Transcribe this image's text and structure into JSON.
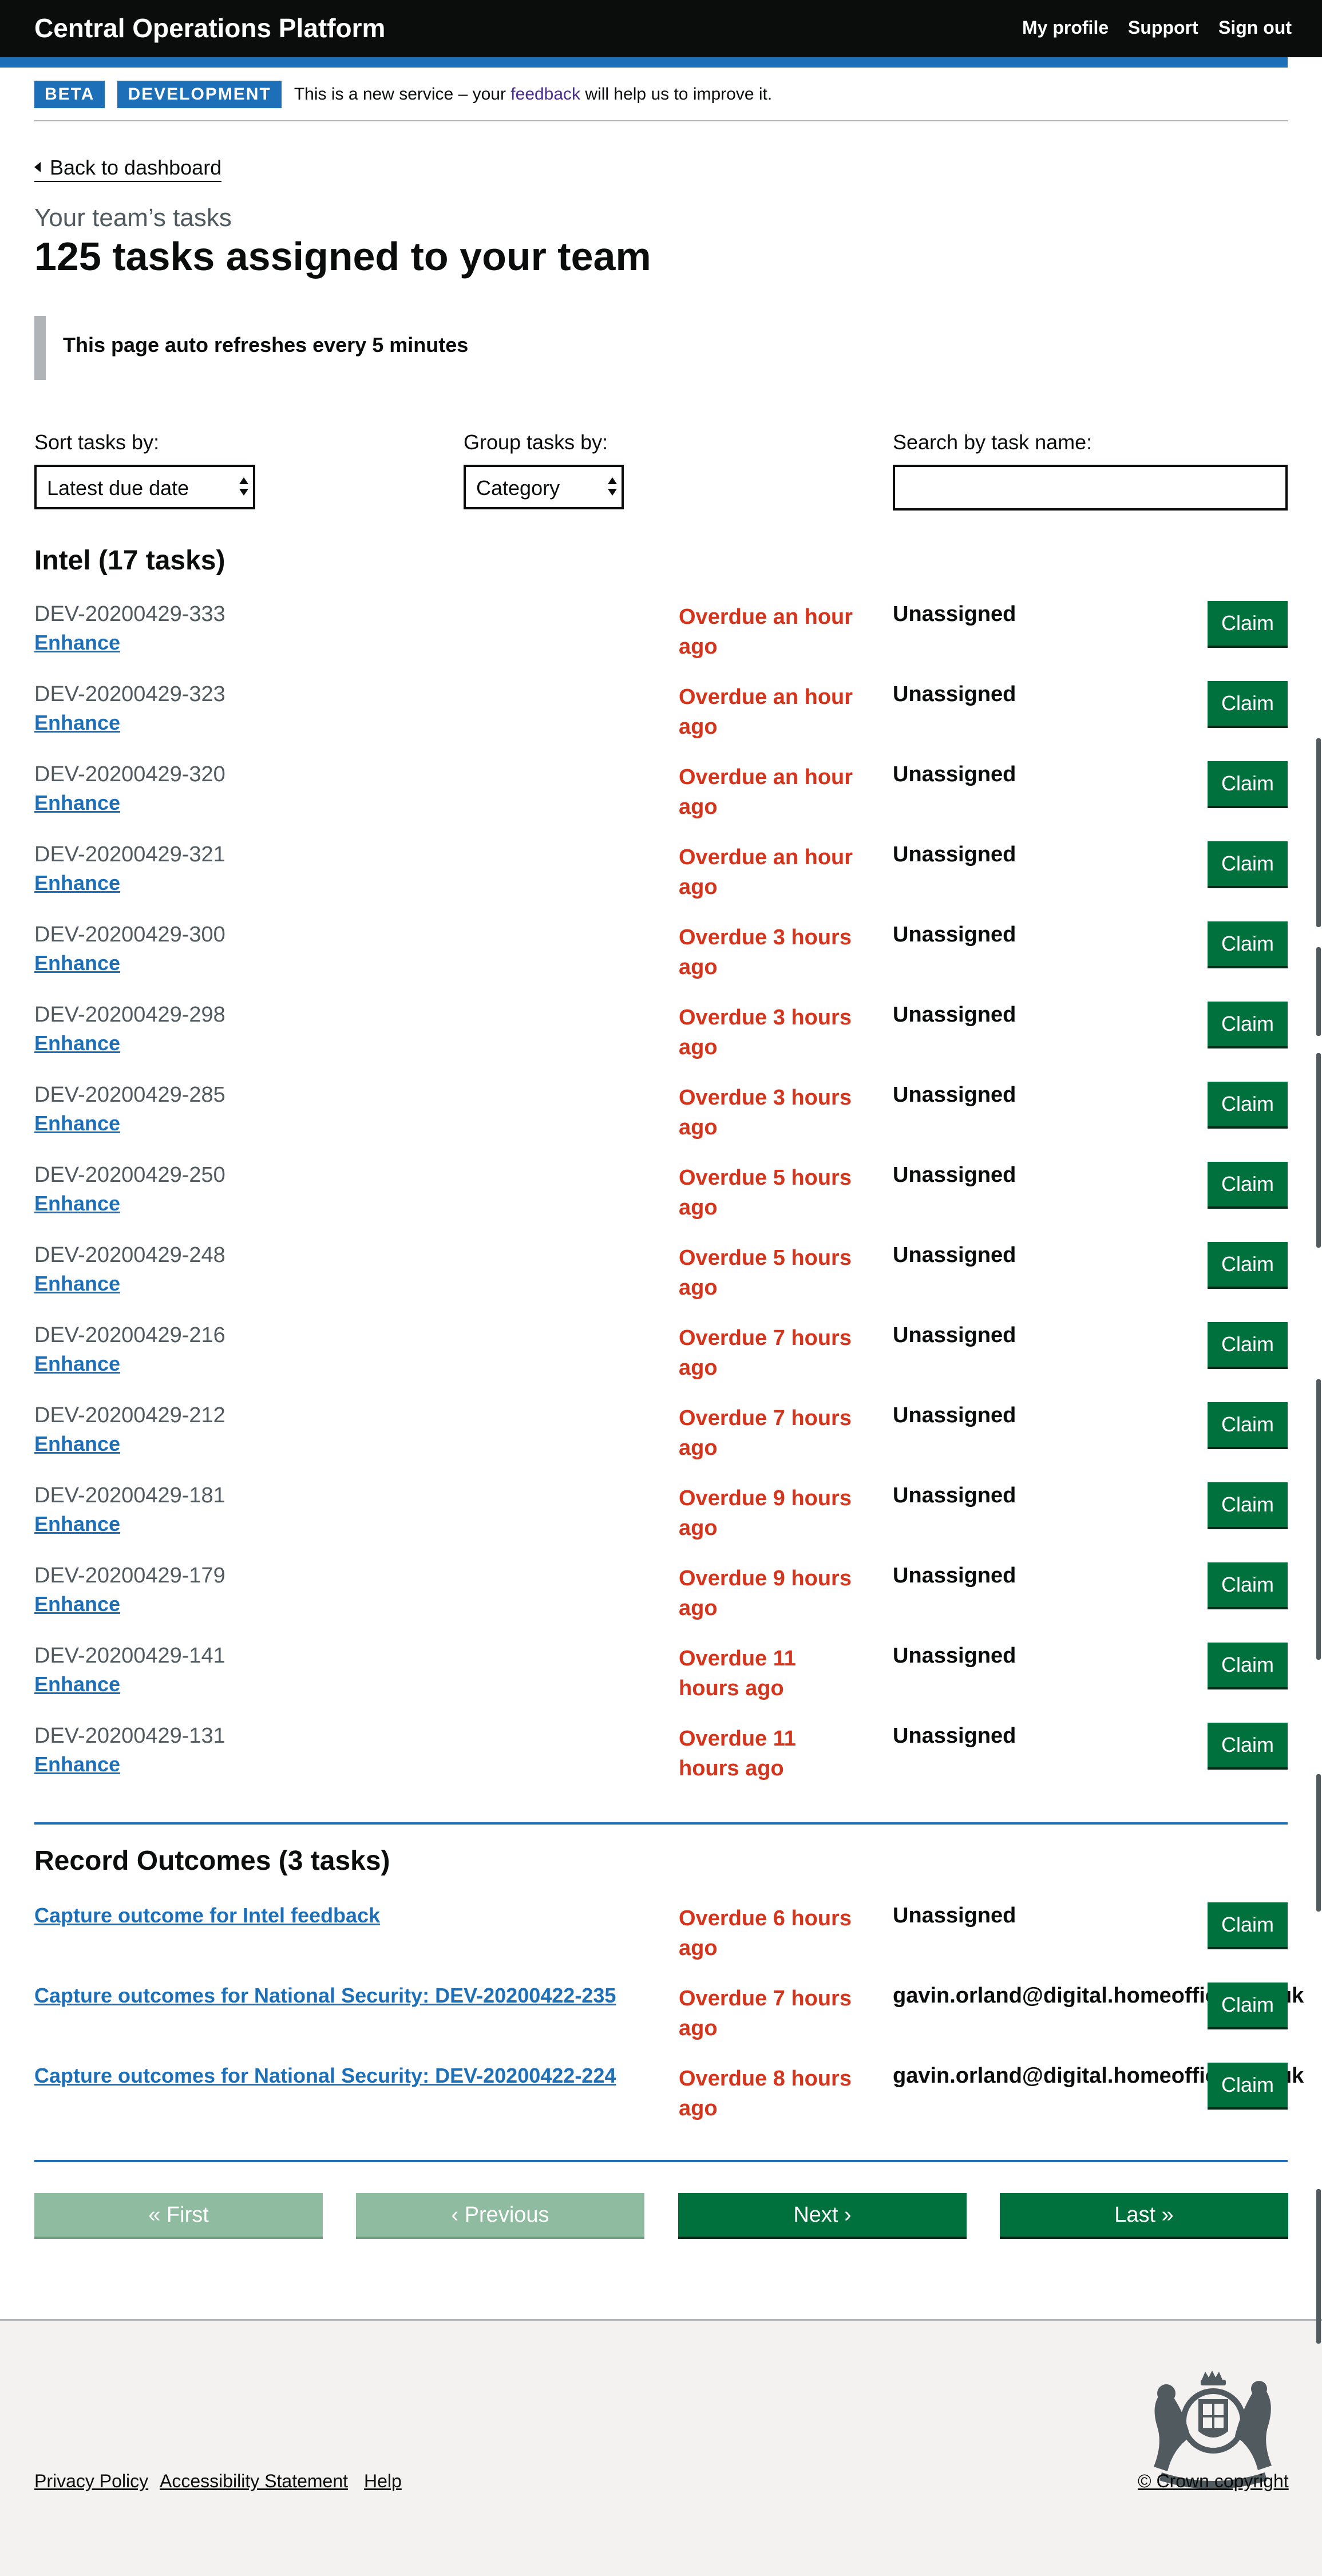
{
  "header": {
    "title": "Central Operations Platform",
    "nav": [
      "My profile",
      "Support",
      "Sign out"
    ]
  },
  "phase_banner": {
    "tags": [
      "BETA",
      "DEVELOPMENT"
    ],
    "text_before": "This is a new service – your",
    "link": "feedback",
    "text_after": "will help us to improve it."
  },
  "back_link": "Back to dashboard",
  "caption": "Your team’s tasks",
  "heading": "125 tasks assigned to your team",
  "inset": "This page auto refreshes every 5 minutes",
  "filters": {
    "sort_label": "Sort tasks by:",
    "sort_value": "Latest due date",
    "group_label": "Group tasks by:",
    "group_value": "Category",
    "search_label": "Search by task name:",
    "search_value": ""
  },
  "intel": {
    "title": "Intel (17 tasks)",
    "claim_label": "Claim",
    "rows": [
      {
        "id": "DEV-20200429-333",
        "task": "Enhance",
        "due_1": "Overdue an hour",
        "due_2": "ago",
        "assignee": "Unassigned"
      },
      {
        "id": "DEV-20200429-323",
        "task": "Enhance",
        "due_1": "Overdue an hour",
        "due_2": "ago",
        "assignee": "Unassigned"
      },
      {
        "id": "DEV-20200429-320",
        "task": "Enhance",
        "due_1": "Overdue an hour",
        "due_2": "ago",
        "assignee": "Unassigned"
      },
      {
        "id": "DEV-20200429-321",
        "task": "Enhance",
        "due_1": "Overdue an hour",
        "due_2": "ago",
        "assignee": "Unassigned"
      },
      {
        "id": "DEV-20200429-300",
        "task": "Enhance",
        "due_1": "Overdue 3 hours",
        "due_2": "ago",
        "assignee": "Unassigned"
      },
      {
        "id": "DEV-20200429-298",
        "task": "Enhance",
        "due_1": "Overdue 3 hours",
        "due_2": "ago",
        "assignee": "Unassigned"
      },
      {
        "id": "DEV-20200429-285",
        "task": "Enhance",
        "due_1": "Overdue 3 hours",
        "due_2": "ago",
        "assignee": "Unassigned"
      },
      {
        "id": "DEV-20200429-250",
        "task": "Enhance",
        "due_1": "Overdue 5 hours",
        "due_2": "ago",
        "assignee": "Unassigned"
      },
      {
        "id": "DEV-20200429-248",
        "task": "Enhance",
        "due_1": "Overdue 5 hours",
        "due_2": "ago",
        "assignee": "Unassigned"
      },
      {
        "id": "DEV-20200429-216",
        "task": "Enhance",
        "due_1": "Overdue 7 hours",
        "due_2": "ago",
        "assignee": "Unassigned"
      },
      {
        "id": "DEV-20200429-212",
        "task": "Enhance",
        "due_1": "Overdue 7 hours",
        "due_2": "ago",
        "assignee": "Unassigned"
      },
      {
        "id": "DEV-20200429-181",
        "task": "Enhance",
        "due_1": "Overdue 9 hours",
        "due_2": "ago",
        "assignee": "Unassigned"
      },
      {
        "id": "DEV-20200429-179",
        "task": "Enhance",
        "due_1": "Overdue 9 hours",
        "due_2": "ago",
        "assignee": "Unassigned"
      },
      {
        "id": "DEV-20200429-141",
        "task": "Enhance",
        "due_1": "Overdue 11",
        "due_2": "hours ago",
        "assignee": "Unassigned"
      },
      {
        "id": "DEV-20200429-131",
        "task": "Enhance",
        "due_1": "Overdue 11",
        "due_2": "hours ago",
        "assignee": "Unassigned"
      }
    ]
  },
  "outcomes": {
    "title": "Record Outcomes (3 tasks)",
    "claim_label": "Claim",
    "rows": [
      {
        "task": "Capture outcome for Intel feedback",
        "due_1": "Overdue 6 hours",
        "due_2": "ago",
        "assignee": "Unassigned"
      },
      {
        "task": "Capture outcomes for National Security: DEV-20200422-235",
        "due_1": "Overdue 7 hours",
        "due_2": "ago",
        "assignee": "gavin.orland@digital.homeoffice.gov.uk"
      },
      {
        "task": "Capture outcomes for National Security: DEV-20200422-224",
        "due_1": "Overdue 8 hours",
        "due_2": "ago",
        "assignee": "gavin.orland@digital.homeoffice.gov.uk"
      }
    ]
  },
  "pagination": {
    "first": "« First",
    "previous": "‹ Previous",
    "next": "Next ›",
    "last": "Last »"
  },
  "footer": {
    "links": [
      "Privacy Policy",
      "Accessibility Statement",
      "Help"
    ],
    "copyright": "© Crown copyright",
    "crest_mottos": [
      "HONI SOIT QUI MAL Y PENSE",
      "DIEU ET MON DROIT"
    ]
  },
  "colors": {
    "header": "#0b0c0c",
    "brand_blue": "#1d70b8",
    "overdue_red": "#d4351c",
    "button_green": "#00703c",
    "link_blue": "#1d70b8"
  }
}
